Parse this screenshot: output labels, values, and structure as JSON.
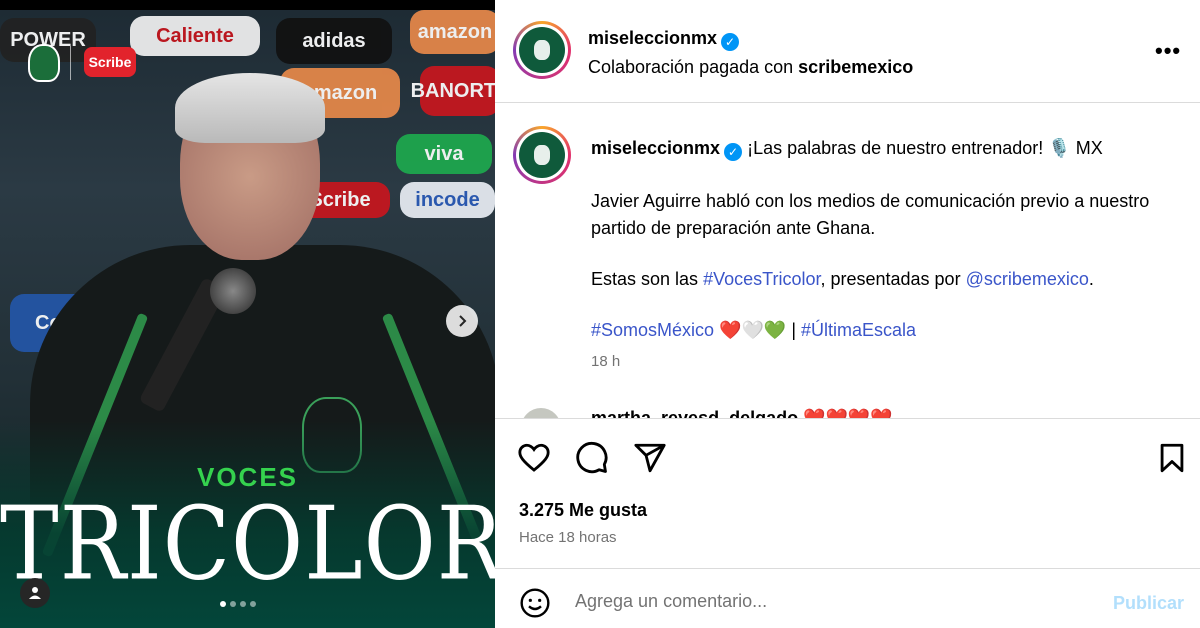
{
  "media": {
    "sponsors": [
      "POWER",
      "Caliente",
      "adidas",
      "amazon",
      "Scribe",
      "Corona",
      "BANORTE",
      "viva",
      "incode"
    ],
    "headline_small": "VOCES",
    "headline_big": "TRICOLOR",
    "logo_scribe": "Scribe",
    "carousel_total": 4,
    "carousel_active": 1
  },
  "header": {
    "username": "miseleccionmx",
    "collab_prefix": "Colaboración pagada con",
    "collab_partner": "scribemexico",
    "more_label": "•••"
  },
  "caption": {
    "username": "miseleccionmx",
    "first_line": "¡Las palabras de nuestro entrenador! 🎙️ MX",
    "paragraph1": "Javier Aguirre habló con los medios de comunicación previo a nuestro partido de preparación ante Ghana.",
    "paragraph2_prefix": "Estas son las",
    "hashtag_voces": "#VocesTricolor",
    "paragraph2_middle": ", presentadas por",
    "mention_scribe": "@scribemexico",
    "paragraph2_suffix": ".",
    "hashtag_somos": "#SomosMéxico",
    "hearts": "❤️🤍💚",
    "separator": "|",
    "hashtag_ultima": "#ÚltimaEscala",
    "time": "18 h"
  },
  "next_comment": {
    "username": "martha_reyesd_delgado",
    "hearts": "❤️❤️❤️❤️"
  },
  "stats": {
    "likes": "3.275 Me gusta",
    "ago": "Hace 18 horas"
  },
  "composer": {
    "placeholder": "Agrega un comentario...",
    "post_label": "Publicar"
  },
  "colors": {
    "accent_blue": "#0095f6",
    "link_blue": "#3a55c9",
    "muted_gray": "#737373",
    "voces_green": "#35d24e"
  },
  "icons": [
    "heart-icon",
    "comment-icon",
    "share-icon",
    "bookmark-icon",
    "emoji-icon",
    "chevron-right-icon",
    "user-tag-icon",
    "verified-icon",
    "more-icon"
  ]
}
